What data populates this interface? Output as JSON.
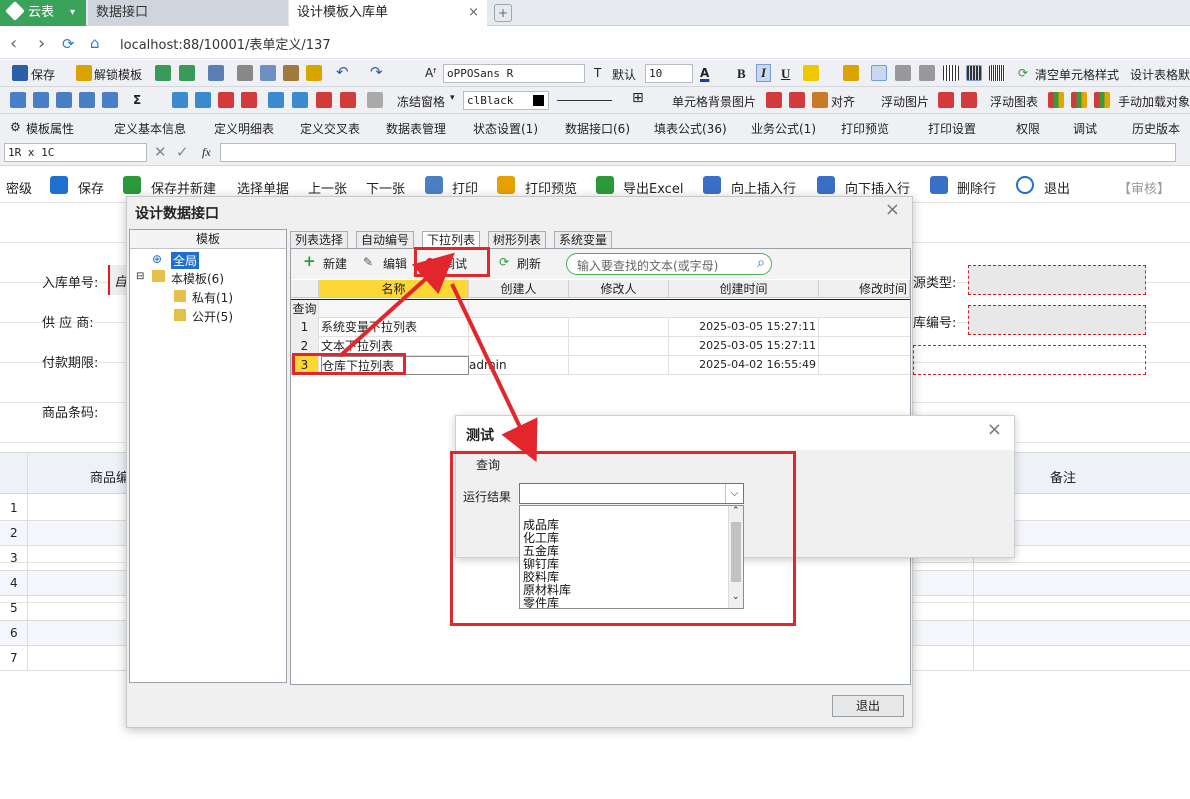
{
  "browser": {
    "app_tab": "云表",
    "tabs": [
      "数据接口",
      "设计模板入库单"
    ],
    "url": "localhost:88/10001/表单定义/137"
  },
  "toolbar1": {
    "save": "保存",
    "unlock": "解锁模板",
    "font_name": "oPPOSans R",
    "default": "默认",
    "font_size": "10",
    "bold": "B",
    "italic": "I",
    "underline": "U",
    "clear_style": "清空单元格样式",
    "design_table": "设计表格默"
  },
  "toolbar2": {
    "sigma": "Σ",
    "freeze": "冻结窗格",
    "color": "clBlack",
    "bg_image": "单元格背景图片",
    "align": "对齐",
    "float_image": "浮动图片",
    "float_chart": "浮动图表",
    "manual_load": "手动加载对象"
  },
  "toolbar3": {
    "template_attr": "模板属性",
    "basic_info": "定义基本信息",
    "detail_table": "定义明细表",
    "cross_table": "定义交叉表",
    "data_mgmt": "数据表管理",
    "status": "状态设置(1)",
    "data_iface": "数据接口(6)",
    "fill_formula": "填表公式(36)",
    "biz_formula": "业务公式(1)",
    "print_preview": "打印预览",
    "print_settings": "打印设置",
    "permission": "权限",
    "debug": "调试",
    "history": "历史版本"
  },
  "formula_bar": {
    "cell_ref": "1R x 1C",
    "fx": "fx"
  },
  "action_bar": {
    "left_cut": "密级",
    "save": "保存",
    "save_new": "保存并新建",
    "select": "选择单据",
    "prev": "上一张",
    "next": "下一张",
    "print": "打印",
    "preview": "打印预览",
    "export": "导出Excel",
    "insert_up": "向上插入行",
    "insert_down": "向下插入行",
    "delete_row": "删除行",
    "exit": "退出",
    "review": "【审核】"
  },
  "form": {
    "inbound_no": "入库单号:",
    "supplier": "供 应 商:",
    "payment": "付款期限:",
    "barcode": "商品条码:",
    "source_type": "源类型:",
    "warehouse_no": "库编号:",
    "inbound_cell_prefix": "自",
    "col_product": "商品编",
    "col_remark": "备注",
    "row_numbers": [
      "1",
      "2",
      "3",
      "4",
      "5",
      "6",
      "7"
    ]
  },
  "dialog": {
    "title": "设计数据接口",
    "tree_header": "模板",
    "tree": {
      "global": "全局",
      "this_template": "本模板(6)",
      "private": "私有(1)",
      "public": "公开(5)"
    },
    "subtabs": [
      "列表选择",
      "自动编号",
      "下拉列表",
      "树形列表",
      "系统变量"
    ],
    "toolbar": {
      "new": "新建",
      "edit": "编辑",
      "debug": "调试",
      "refresh": "刷新",
      "search_placeholder": "输入要查找的文本(或字母)"
    },
    "columns": [
      "名称",
      "创建人",
      "修改人",
      "创建时间",
      "修改时间"
    ],
    "query_label": "查询",
    "rows": [
      {
        "no": "1",
        "name": "系统变量下拉列表",
        "creator": "",
        "modifier": "",
        "created": "2025-03-05 15:27:11"
      },
      {
        "no": "2",
        "name": "文本下拉列表",
        "creator": "",
        "modifier": "",
        "created": "2025-03-05 15:27:11"
      },
      {
        "no": "3",
        "name": "仓库下拉列表",
        "creator": "admin",
        "modifier": "",
        "created": "2025-04-02 16:55:49"
      }
    ],
    "exit": "退出"
  },
  "test_dialog": {
    "title": "测试",
    "query": "查询",
    "result_label": "运行结果",
    "options": [
      "成品库",
      "化工库",
      "五金库",
      "铆钉库",
      "胶料库",
      "原材料库",
      "零件库"
    ]
  },
  "colors": {
    "accent_red": "#e3262b",
    "app_green": "#3aa35a",
    "selection_yellow": "#fdd835"
  }
}
